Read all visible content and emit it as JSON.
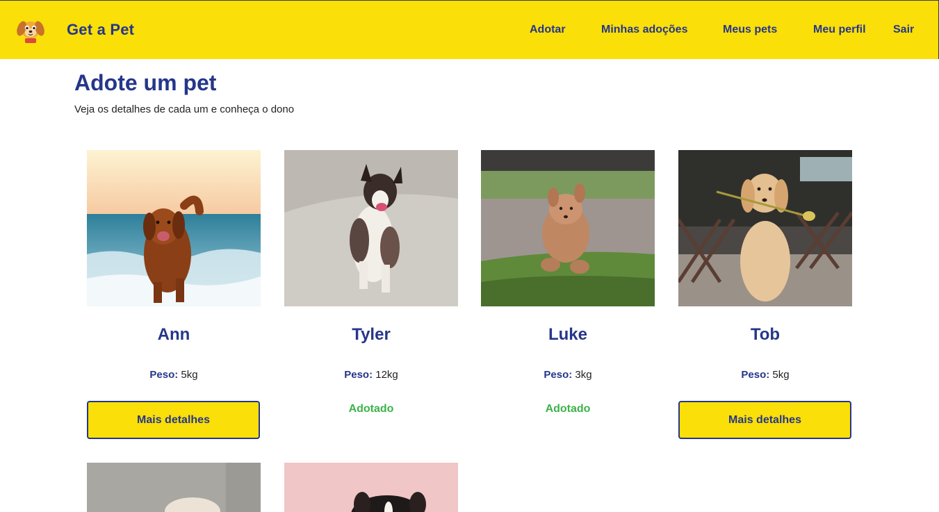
{
  "app": {
    "name": "Get a Pet",
    "logo_icon": "puppy-logo-icon"
  },
  "nav": {
    "items": [
      {
        "label": "Adotar"
      },
      {
        "label": "Minhas adoções"
      },
      {
        "label": "Meus pets"
      },
      {
        "label": "Meu perfil"
      },
      {
        "label": "Sair"
      }
    ]
  },
  "page": {
    "title": "Adote um pet",
    "subtitle": "Veja os detalhes de cada um e conheça o dono"
  },
  "pets": [
    {
      "name": "Ann",
      "weight_label": "Peso:",
      "weight": "5kg",
      "button": "Mais detalhes",
      "adopted": false,
      "photo": "brown dog running on beach"
    },
    {
      "name": "Tyler",
      "weight_label": "Peso:",
      "weight": "12kg",
      "status": "Adotado",
      "adopted": true,
      "photo": "tricolor dog running on sand"
    },
    {
      "name": "Luke",
      "weight_label": "Peso:",
      "weight": "3kg",
      "status": "Adotado",
      "adopted": true,
      "photo": "small curly dog jumping on grass"
    },
    {
      "name": "Tob",
      "weight_label": "Peso:",
      "weight": "5kg",
      "button": "Mais detalhes",
      "adopted": false,
      "photo": "golden dog holding a rose"
    }
  ],
  "colors": {
    "navbar": "#fadf09",
    "primary": "#25368a",
    "adopted": "#3cb24a",
    "button": "#fadf09"
  }
}
